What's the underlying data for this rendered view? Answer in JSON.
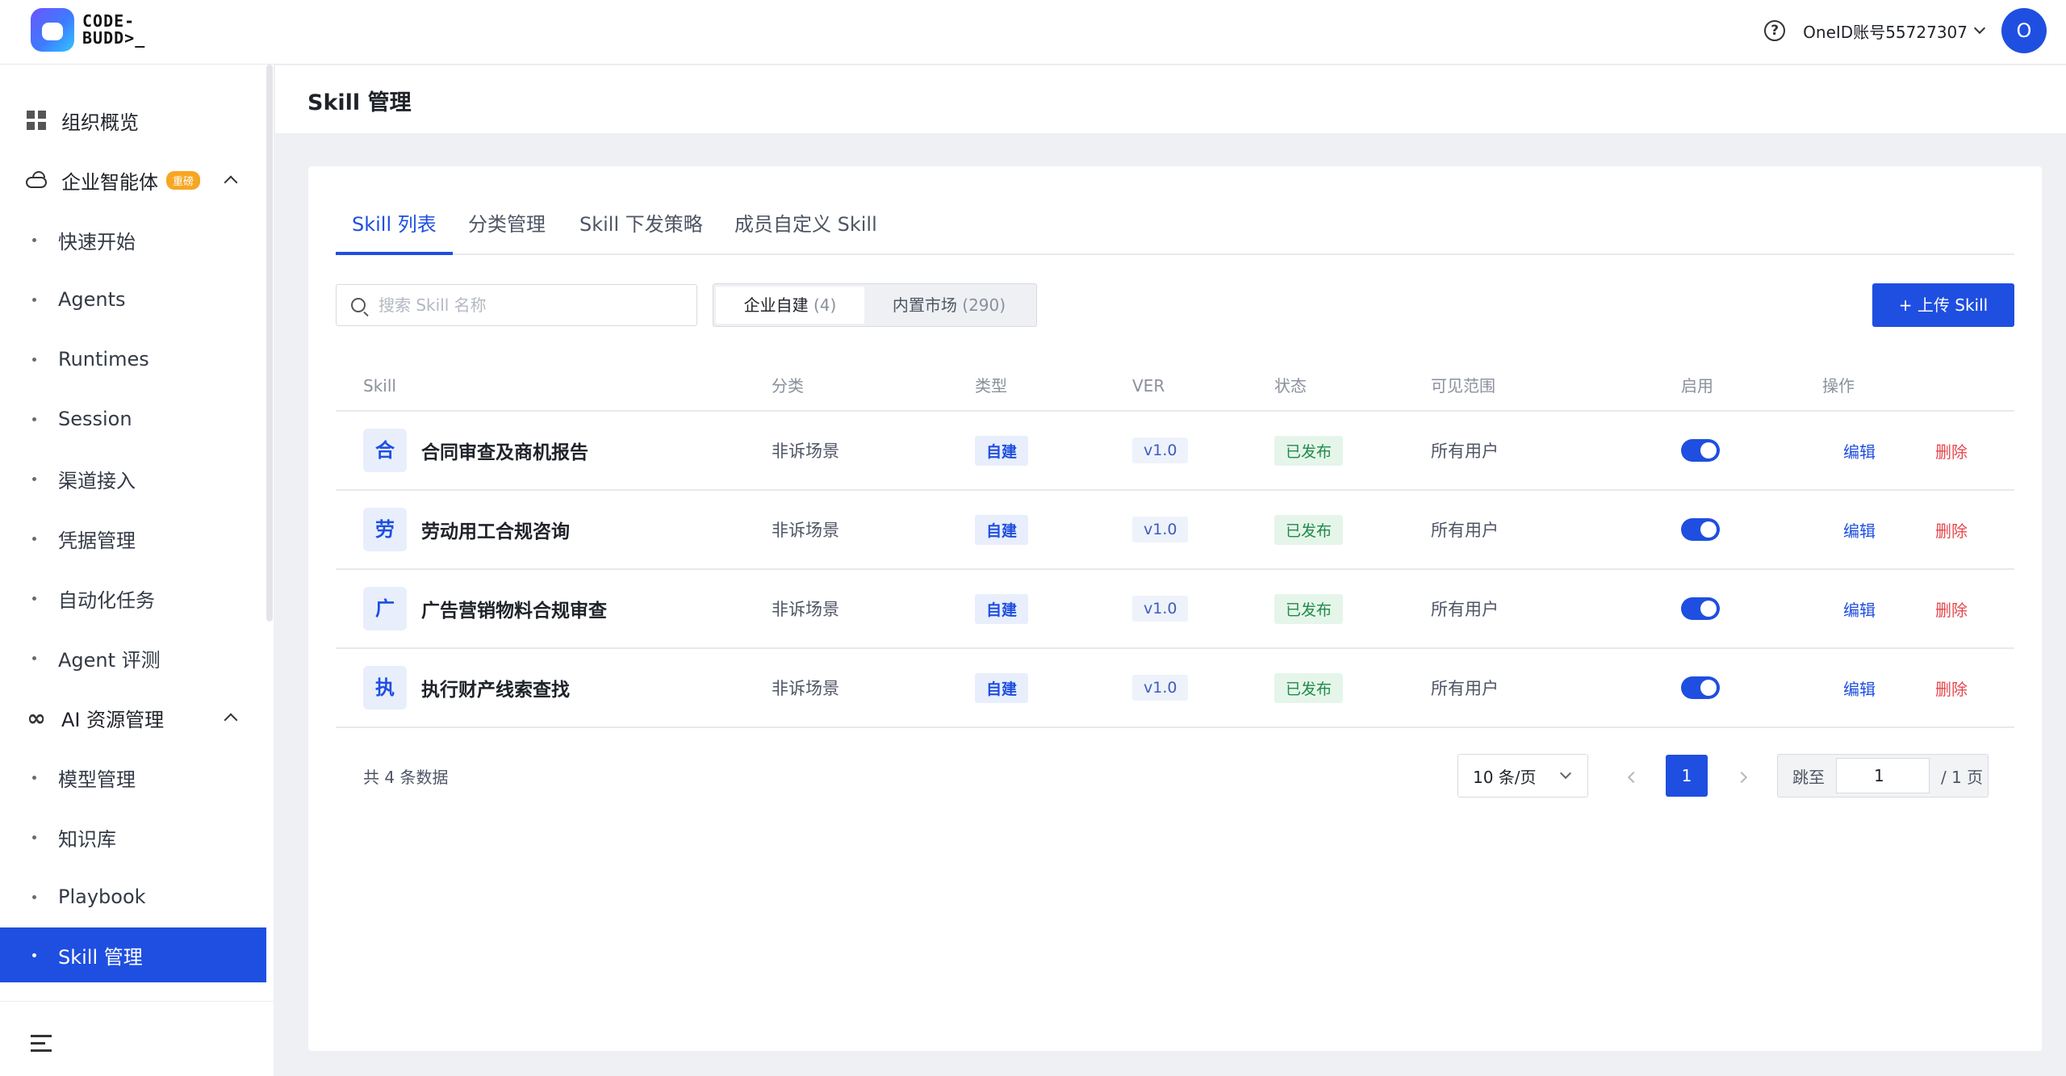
{
  "header": {
    "logo_line1": "CODE-",
    "logo_line2": "BUDD>_",
    "help_icon": "question-circle-icon",
    "account": "OneID账号55727307",
    "avatar_letter": "O"
  },
  "sidebar": {
    "items": [
      {
        "label": "组织概览",
        "icon": "dashboard-grid-icon"
      },
      {
        "label": "企业智能体",
        "icon": "cloud-icon",
        "badge": "重磅"
      },
      {
        "label": "快速开始"
      },
      {
        "label": "Agents"
      },
      {
        "label": "Runtimes"
      },
      {
        "label": "Session"
      },
      {
        "label": "渠道接入"
      },
      {
        "label": "凭据管理"
      },
      {
        "label": "自动化任务"
      },
      {
        "label": "Agent 评测"
      },
      {
        "label": "AI 资源管理",
        "icon": "infinity-icon"
      },
      {
        "label": "模型管理"
      },
      {
        "label": "知识库"
      },
      {
        "label": "Playbook"
      },
      {
        "label": "Skill 管理"
      }
    ]
  },
  "page": {
    "title": "Skill 管理"
  },
  "tabs": [
    "Skill 列表",
    "分类管理",
    "Skill 下发策略",
    "成员自定义 Skill"
  ],
  "search": {
    "placeholder": "搜索 Skill 名称"
  },
  "segment": {
    "enterprise_label": "企业自建",
    "enterprise_count": "(4)",
    "market_label": "内置市场",
    "market_count": "(290)"
  },
  "upload_button": "+ 上传 Skill",
  "table": {
    "columns": [
      "Skill",
      "分类",
      "类型",
      "VER",
      "状态",
      "可见范围",
      "启用",
      "操作"
    ],
    "rows": [
      {
        "chip": "合",
        "name": "合同审查及商机报告",
        "category": "非诉场景",
        "type": "自建",
        "ver": "v1.0",
        "status": "已发布",
        "scope": "所有用户",
        "enabled": true,
        "edit": "编辑",
        "delete": "删除"
      },
      {
        "chip": "劳",
        "name": "劳动用工合规咨询",
        "category": "非诉场景",
        "type": "自建",
        "ver": "v1.0",
        "status": "已发布",
        "scope": "所有用户",
        "enabled": true,
        "edit": "编辑",
        "delete": "删除"
      },
      {
        "chip": "广",
        "name": "广告营销物料合规审查",
        "category": "非诉场景",
        "type": "自建",
        "ver": "v1.0",
        "status": "已发布",
        "scope": "所有用户",
        "enabled": true,
        "edit": "编辑",
        "delete": "删除"
      },
      {
        "chip": "执",
        "name": "执行财产线索查找",
        "category": "非诉场景",
        "type": "自建",
        "ver": "v1.0",
        "status": "已发布",
        "scope": "所有用户",
        "enabled": true,
        "edit": "编辑",
        "delete": "删除"
      }
    ]
  },
  "pagination": {
    "total": "共 4 条数据",
    "page_size": "10 条/页",
    "current_page": "1",
    "jump_label": "跳至",
    "jump_value": "1",
    "total_pages": "/ 1 页"
  },
  "colors": {
    "primary": "#1f4fe0",
    "danger": "#e5484d",
    "success": "#1f8a48",
    "badge": "#f7a623"
  }
}
